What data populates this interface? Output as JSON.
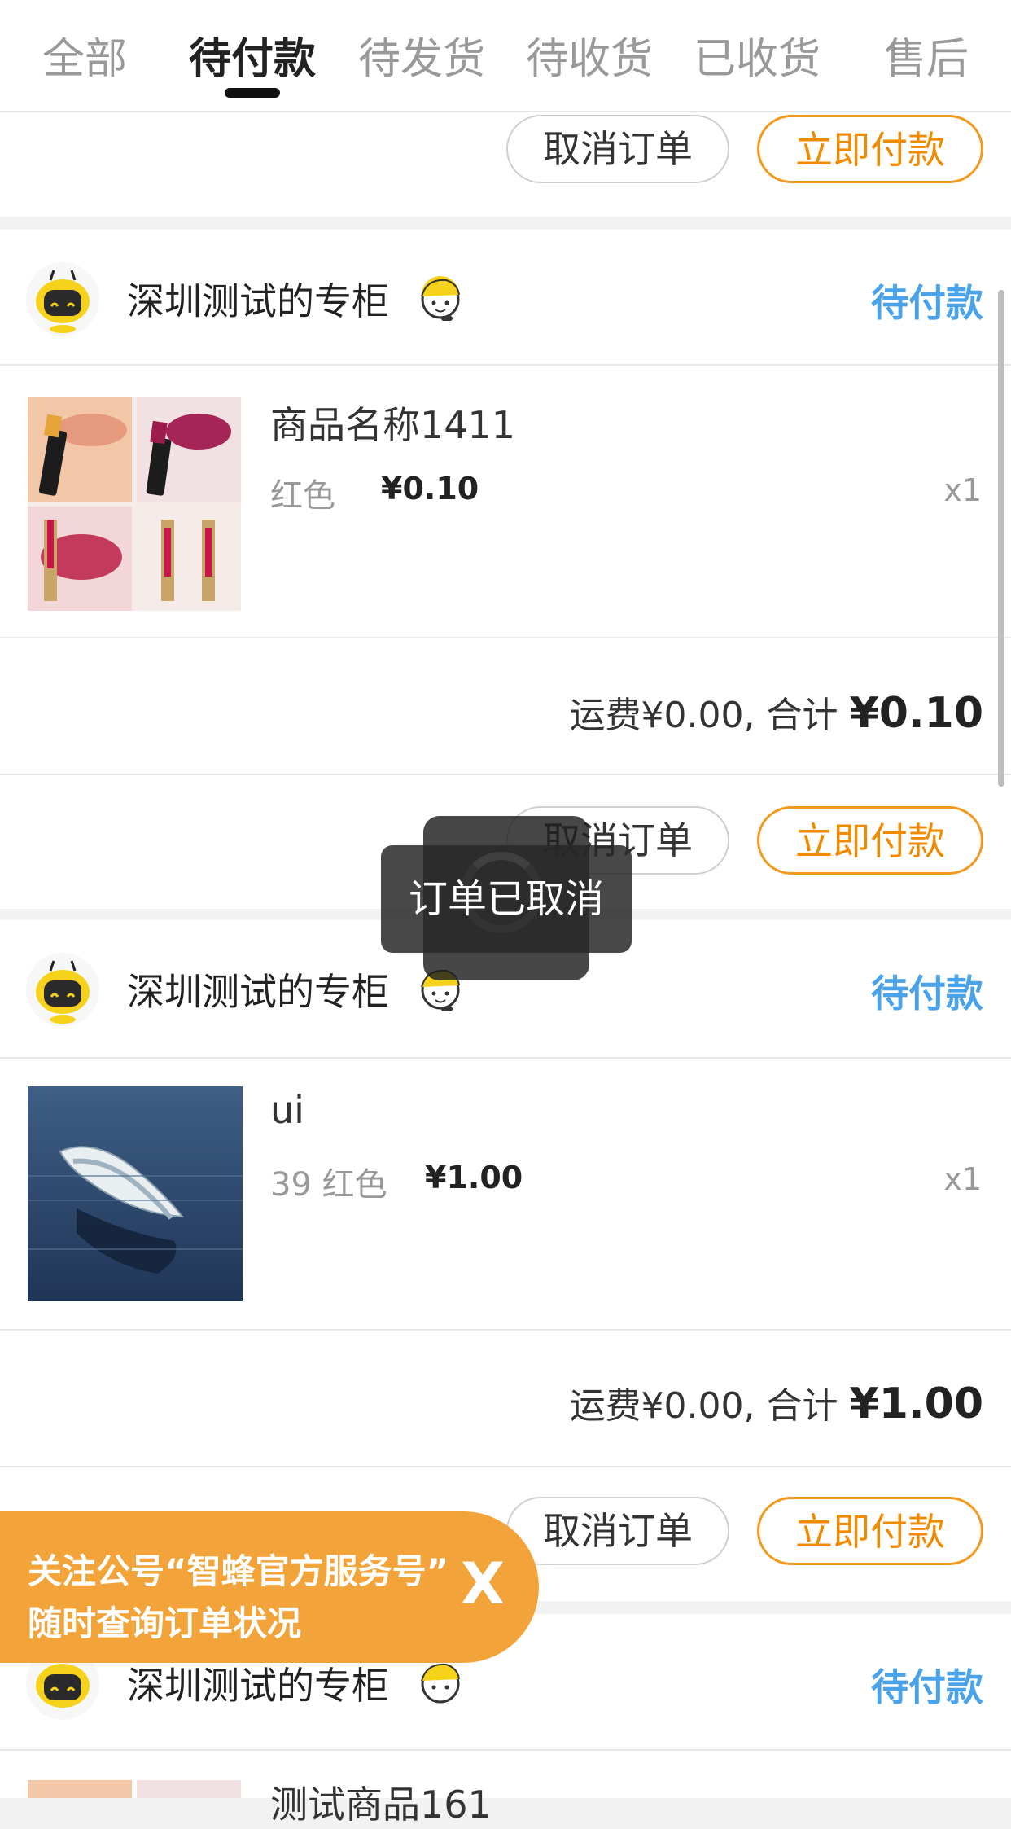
{
  "tabs": [
    "全部",
    "待付款",
    "待发货",
    "待收货",
    "已收货",
    "售后"
  ],
  "actions": {
    "cancel": "取消订单",
    "pay": "立即付款"
  },
  "orders": [
    {
      "shop": "深圳测试的专柜",
      "status": "待付款",
      "product": {
        "name": "商品名称1411",
        "variant": "红色",
        "price": "¥0.10",
        "qty": "x1",
        "image": "lipstick-image"
      },
      "summary": {
        "shipping": "运费¥0.00,",
        "total_label": "合计",
        "total": "¥0.10"
      }
    },
    {
      "shop": "深圳测试的专柜",
      "status": "待付款",
      "product": {
        "name": "ui",
        "variant": "39 红色",
        "price": "¥1.00",
        "qty": "x1",
        "image": "boat-image"
      },
      "summary": {
        "shipping": "运费¥0.00,",
        "total_label": "合计",
        "total": "¥1.00"
      }
    },
    {
      "shop": "深圳测试的专柜",
      "status": "待付款",
      "product": {
        "name": "测试商品161"
      }
    }
  ],
  "toast": "订单已取消",
  "banner": {
    "line1": "关注公号“智蜂官方服务号”",
    "line2": "随时查询订单状况",
    "close": "X"
  },
  "colors": {
    "accent": "#f08a00",
    "status": "#4aa3e8",
    "banner": "#f2a43a"
  }
}
